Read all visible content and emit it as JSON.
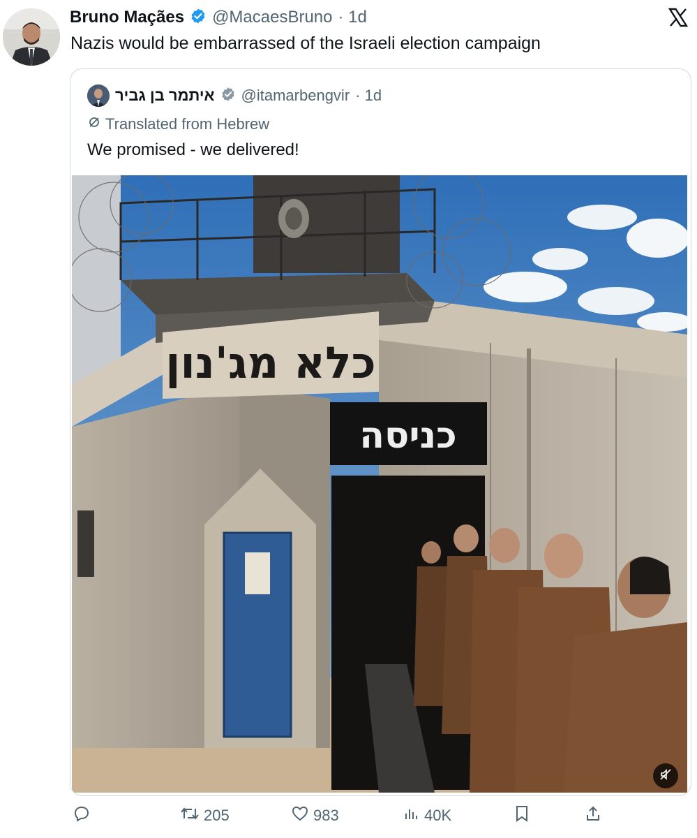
{
  "tweet": {
    "author_name": "Bruno Maçães",
    "handle": "@MacaesBruno",
    "time": "· 1d",
    "text": "Nazis would be embarrassed of the Israeli election campaign"
  },
  "quote": {
    "author_name": "איתמר בן גביר",
    "handle": "@itamarbengvir",
    "time": "· 1d",
    "translated_label": "Translated from Hebrew",
    "text": "We promised - we delivered!",
    "image": {
      "sign_top": "כלא מג'נון",
      "sign_entrance": "כניסה"
    }
  },
  "actions": {
    "retweets": "205",
    "likes": "983",
    "views": "40K"
  },
  "colors": {
    "text": "#0f1419",
    "secondary": "#536471",
    "verified": "#1d9bf0",
    "card_border": "#cfd9de"
  },
  "icons": [
    "verified-badge-icon",
    "x-logo-icon",
    "translate-icon",
    "mute-icon",
    "reply-icon",
    "retweet-icon",
    "like-icon",
    "views-icon",
    "bookmark-icon",
    "share-icon"
  ]
}
